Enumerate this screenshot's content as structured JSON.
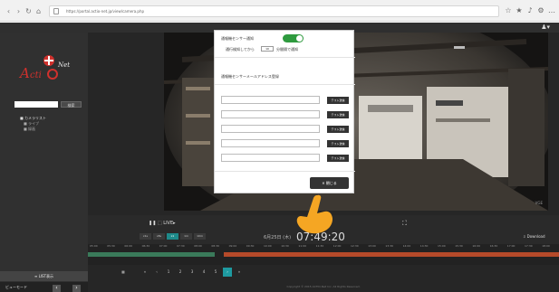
{
  "browser": {
    "back_icon": "‹",
    "forward_icon": "›",
    "reload_icon": "↻",
    "home_icon": "⌂",
    "url": "https://portal.actio-net.jp/view/camera.php",
    "toolbar_icons": [
      "☆",
      "★",
      "♪",
      "⚙",
      "…"
    ]
  },
  "app": {
    "user_menu": "♟▾"
  },
  "sidebar": {
    "search_placeholder": "",
    "search_button": "検索",
    "tree": [
      "■ カメラリスト",
      "■ ライブ",
      "■ 録画"
    ],
    "list_button": "≡ LIST表示",
    "bottom_label": "ビューモード",
    "prev": "‹",
    "next": "›"
  },
  "camera": {
    "label": "VGE"
  },
  "controls": {
    "play_label": "❚❚ ⬚ LIVE▸",
    "speeds": [
      "x1s",
      "x8s",
      "x1",
      "1m",
      "10m"
    ],
    "active_speed_index": 2,
    "date": "6月25日 (木)",
    "time": "07:49:20",
    "fullscreen_icon": "⛶",
    "download_label": "⇩ Download"
  },
  "timeline": {
    "ticks": [
      "05:00",
      "05:30",
      "06:00",
      "06:30",
      "07:00",
      "07:30",
      "08:00",
      "08:30",
      "09:00",
      "09:30",
      "10:00",
      "10:30",
      "11:00",
      "11:30",
      "12:00",
      "12:30",
      "13:00",
      "13:30",
      "14:00",
      "14:30",
      "15:00",
      "15:30",
      "16:00",
      "16:30",
      "17:00",
      "17:30",
      "18:00"
    ]
  },
  "pagination": {
    "first": "▦",
    "pages": [
      "«",
      "‹",
      "1",
      "2",
      "3",
      "4",
      "5",
      "›",
      "»"
    ],
    "active_index": 7
  },
  "footer": {
    "text": "Copyright © 2015 ACTIO-Net Inc. All Rights Reserved."
  },
  "modal": {
    "title": "通報機センサー通知",
    "toggle_on": true,
    "delay_label_pre": "通行検知してから",
    "delay_value": "10",
    "delay_label_post": "分間隔で通知",
    "email_section_title": "通報機センサーメールアドレス登録",
    "email_values": [
      "",
      "",
      "",
      "",
      ""
    ],
    "test_button": "テスト送信",
    "close_button": "✕ 閉じる"
  },
  "colors": {
    "toggle_green": "#2e9a3e",
    "accent_teal": "#1e9aa0",
    "timeline_green": "#3a7a5a",
    "timeline_red": "#b54a2a",
    "hand_orange": "#f5a623"
  }
}
